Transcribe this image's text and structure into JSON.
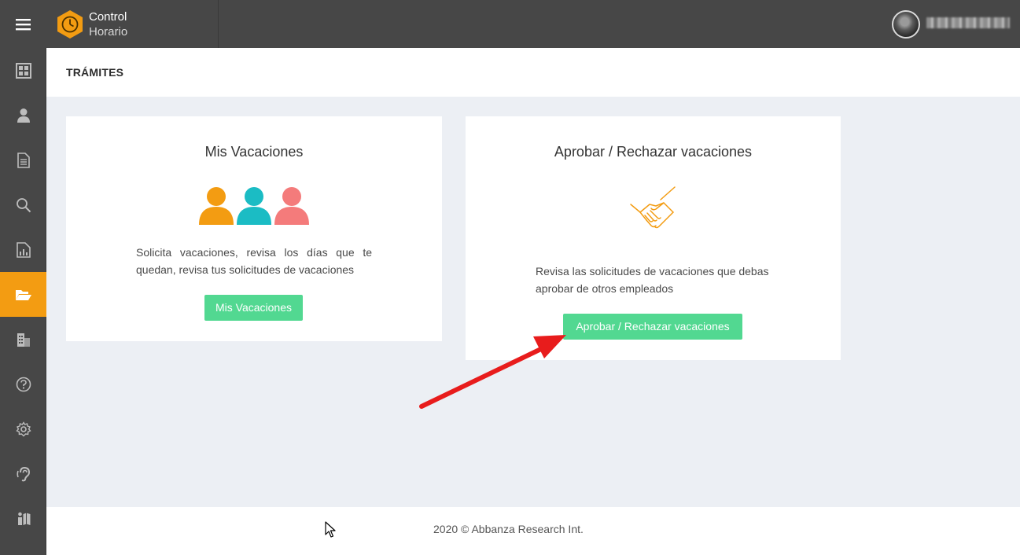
{
  "app": {
    "title_line1": "Control",
    "title_line2": "Horario",
    "accent_color": "#f39c12",
    "logo_icon": "clock-icon"
  },
  "topbar": {
    "menu_icon": "hamburger-icon",
    "user_avatar": "avatar"
  },
  "sidebar": {
    "items": [
      {
        "icon": "dashboard-icon",
        "active": false
      },
      {
        "icon": "user-icon",
        "active": false
      },
      {
        "icon": "document-icon",
        "active": false
      },
      {
        "icon": "search-icon",
        "active": false
      },
      {
        "icon": "report-icon",
        "active": false
      },
      {
        "icon": "folder-open-icon",
        "active": true
      },
      {
        "icon": "building-icon",
        "active": false
      },
      {
        "icon": "help-icon",
        "active": false
      },
      {
        "icon": "settings-icon",
        "active": false
      },
      {
        "icon": "hearing-icon",
        "active": false
      },
      {
        "icon": "map-icon",
        "active": false
      }
    ]
  },
  "page": {
    "title": "TRÁMITES"
  },
  "cards": [
    {
      "title": "Mis Vacaciones",
      "icon": "people-group-icon",
      "description": "Solicita vacaciones, revisa los días que te quedan, revisa tus solicitudes de vacaciones",
      "button": "Mis Vacaciones"
    },
    {
      "title": "Aprobar / Rechazar vacaciones",
      "icon": "handshake-icon",
      "description_line1": "Revisa las solicitudes de vacaciones que debas",
      "description_line2": "aprobar de otros empleados",
      "button": "Aprobar / Rechazar vacaciones"
    }
  ],
  "footer": {
    "text": "2020 © Abbanza Research Int."
  },
  "colors": {
    "button_green": "#52d891",
    "annotation_arrow": "#e81c1c"
  }
}
